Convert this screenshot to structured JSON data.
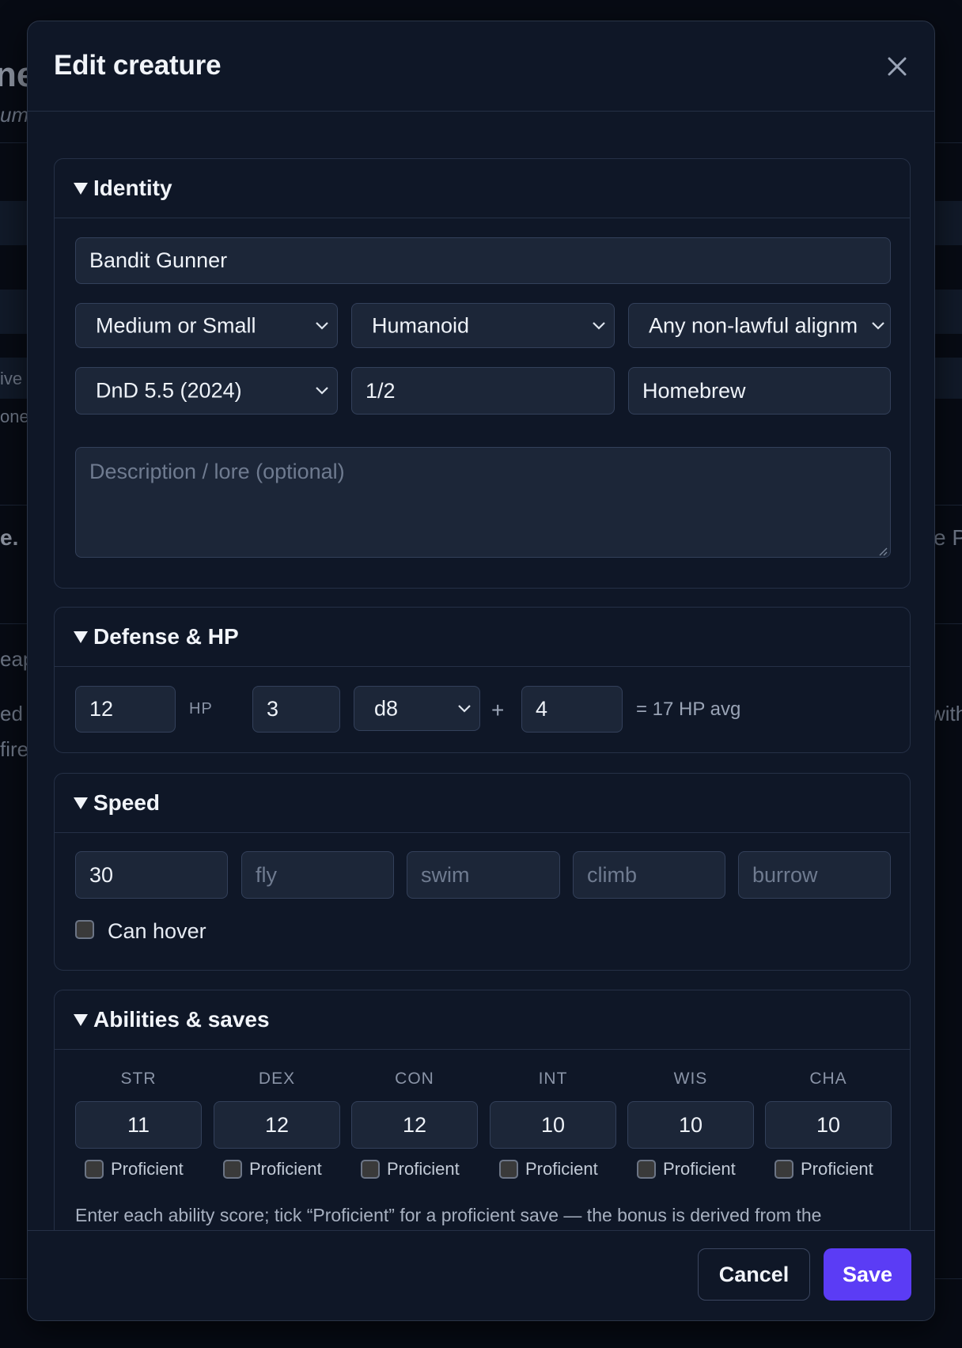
{
  "background": {
    "fragments": [
      "ne",
      "um",
      "ive",
      "one",
      "e.",
      "e P",
      "eap",
      "ed W",
      "fire",
      "with"
    ]
  },
  "modal": {
    "title": "Edit creature",
    "close_icon": "close-icon",
    "footer": {
      "cancel_label": "Cancel",
      "save_label": "Save",
      "save_color": "#5b3cf5"
    }
  },
  "identity": {
    "title": "Identity",
    "name_value": "Bandit Gunner",
    "size_value": "Medium or Small",
    "type_value": "Humanoid",
    "alignment_value": "Any non-lawful alignm",
    "ruleset_value": "DnD 5.5 (2024)",
    "cr_value": "1/2",
    "source_value": "Homebrew",
    "description_placeholder": "Description / lore (optional)"
  },
  "defense": {
    "title": "Defense & HP",
    "ac_value": "12",
    "hp_label": "HP",
    "hit_dice_count": "3",
    "hit_die_value": "d8",
    "plus_sign": "+",
    "hp_bonus": "4",
    "hp_avg_text": "= 17 HP avg"
  },
  "speed": {
    "title": "Speed",
    "walk_value": "30",
    "fly_placeholder": "fly",
    "swim_placeholder": "swim",
    "climb_placeholder": "climb",
    "burrow_placeholder": "burrow",
    "hover_label": "Can hover",
    "hover_checked": false
  },
  "abilities": {
    "title": "Abilities & saves",
    "items": [
      {
        "name": "STR",
        "value": "11",
        "proficient_label": "Proficient"
      },
      {
        "name": "DEX",
        "value": "12",
        "proficient_label": "Proficient"
      },
      {
        "name": "CON",
        "value": "12",
        "proficient_label": "Proficient"
      },
      {
        "name": "INT",
        "value": "10",
        "proficient_label": "Proficient"
      },
      {
        "name": "WIS",
        "value": "10",
        "proficient_label": "Proficient"
      },
      {
        "name": "CHA",
        "value": "10",
        "proficient_label": "Proficient"
      }
    ],
    "help_text": "Enter each ability score; tick “Proficient” for a proficient save — the bonus is derived from the modifier + proficiency bonus (set the CR above)."
  }
}
